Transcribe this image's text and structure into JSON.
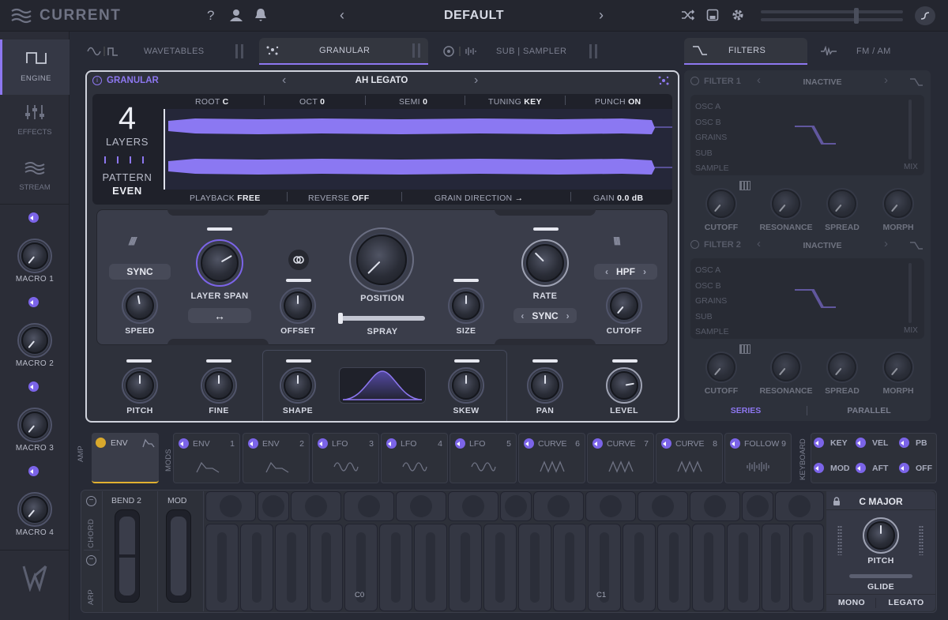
{
  "header": {
    "app_name": "CURRENT",
    "preset": "DEFAULT"
  },
  "sidebar": {
    "nav": [
      {
        "label": "ENGINE"
      },
      {
        "label": "EFFECTS"
      },
      {
        "label": "STREAM"
      }
    ],
    "macros": [
      "MACRO 1",
      "MACRO 2",
      "MACRO 3",
      "MACRO 4"
    ]
  },
  "top_tabs": {
    "wavetables": "WAVETABLES",
    "granular": "GRANULAR",
    "sub_sampler": "SUB | SAMPLER",
    "filters": "FILTERS",
    "fm_am": "FM / AM"
  },
  "granular": {
    "title": "GRANULAR",
    "sample": "AH LEGATO",
    "layers_count": "4",
    "layers_label": "LAYERS",
    "pattern_label": "PATTERN",
    "pattern_value": "EVEN",
    "params_top": [
      {
        "label": "ROOT",
        "value": "C"
      },
      {
        "label": "OCT",
        "value": "0"
      },
      {
        "label": "SEMI",
        "value": "0"
      },
      {
        "label": "TUNING",
        "value": "KEY"
      },
      {
        "label": "PUNCH",
        "value": "ON"
      }
    ],
    "params_bottom": [
      {
        "label": "PLAYBACK",
        "value": "FREE"
      },
      {
        "label": "REVERSE",
        "value": "OFF"
      },
      {
        "label": "GRAIN DIRECTION",
        "value": "→"
      },
      {
        "label": "GAIN",
        "value": "0.0 dB"
      }
    ],
    "controls": {
      "sync": "SYNC",
      "speed": "SPEED",
      "layer_span": "LAYER SPAN",
      "offset": "OFFSET",
      "position": "POSITION",
      "spray": "SPRAY",
      "size": "SIZE",
      "rate": "RATE",
      "rate_sync": "SYNC",
      "filter_type": "HPF",
      "cutoff": "CUTOFF"
    },
    "bottom_row": {
      "pitch": "PITCH",
      "fine": "FINE",
      "shape": "SHAPE",
      "skew": "SKEW",
      "pan": "PAN",
      "level": "LEVEL"
    }
  },
  "filters": {
    "filter1": {
      "title": "FILTER 1",
      "status": "INACTIVE"
    },
    "filter2": {
      "title": "FILTER 2",
      "status": "INACTIVE"
    },
    "sources": [
      "OSC A",
      "OSC B",
      "GRAINS",
      "SUB",
      "SAMPLE"
    ],
    "mix": "MIX",
    "knobs": [
      "CUTOFF",
      "RESONANCE",
      "SPREAD",
      "MORPH"
    ],
    "routing": [
      "SERIES",
      "PARALLEL"
    ]
  },
  "mods": {
    "amp_label": "AMP",
    "mods_label": "MODS",
    "keyboard_label": "KEYBOARD",
    "amp_env": "ENV",
    "slots": [
      {
        "name": "ENV",
        "num": "1"
      },
      {
        "name": "ENV",
        "num": "2"
      },
      {
        "name": "LFO",
        "num": "3"
      },
      {
        "name": "LFO",
        "num": "4"
      },
      {
        "name": "LFO",
        "num": "5"
      },
      {
        "name": "CURVE",
        "num": "6"
      },
      {
        "name": "CURVE",
        "num": "7"
      },
      {
        "name": "CURVE",
        "num": "8"
      },
      {
        "name": "FOLLOW",
        "num": "9"
      }
    ],
    "keyboard_sources": [
      "KEY",
      "VEL",
      "PB",
      "MOD",
      "AFT",
      "OFF"
    ]
  },
  "keyboard": {
    "bend_label": "BEND",
    "bend_value": "2",
    "mod_label": "MOD",
    "chord": "CHORD",
    "arp": "ARP",
    "octave_labels": [
      "C0",
      "C1"
    ],
    "scale": "C MAJOR",
    "pitch": "PITCH",
    "glide": "GLIDE",
    "mono": "MONO",
    "legato": "LEGATO"
  },
  "colors": {
    "accent": "#8d77f0",
    "waveform": "#8b78f2",
    "background": "#272a35"
  }
}
